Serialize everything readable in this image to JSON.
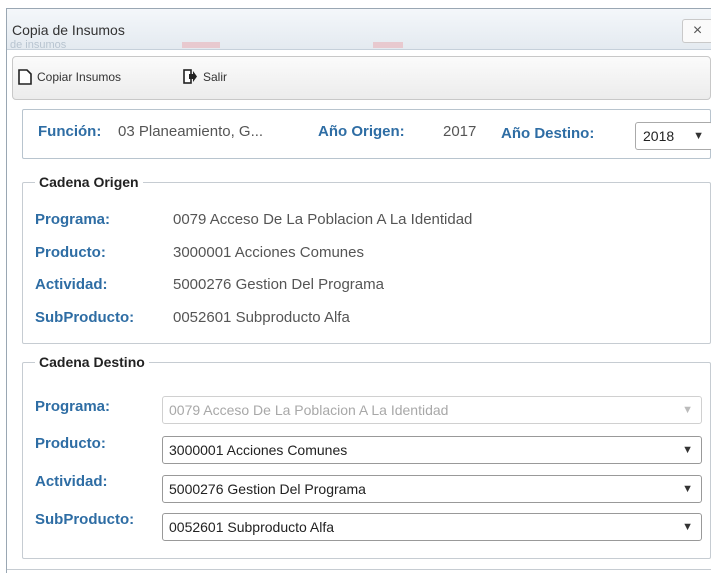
{
  "window": {
    "title": "Copia de Insumos",
    "close_symbol": "×",
    "background_ghost_text": "de insumos"
  },
  "toolbar": {
    "copy_label": "Copiar Insumos",
    "exit_label": "Salir"
  },
  "header": {
    "funcion_label": "Función:",
    "funcion_value": "03 Planeamiento, G...",
    "anio_origen_label": "Año Origen:",
    "anio_origen_value": "2017",
    "anio_destino_label": "Año Destino:",
    "anio_destino_value": "2018"
  },
  "origen": {
    "legend": "Cadena Origen",
    "rows": [
      {
        "label": "Programa:",
        "value": "0079 Acceso De La Poblacion A La Identidad"
      },
      {
        "label": "Producto:",
        "value": "3000001 Acciones Comunes"
      },
      {
        "label": "Actividad:",
        "value": "5000276 Gestion Del Programa"
      },
      {
        "label": "SubProducto:",
        "value": "0052601 Subproducto Alfa"
      }
    ]
  },
  "destino": {
    "legend": "Cadena Destino",
    "rows": [
      {
        "label": "Programa:",
        "value": "0079 Acceso De La Poblacion A La Identidad",
        "disabled": true
      },
      {
        "label": "Producto:",
        "value": "3000001 Acciones Comunes"
      },
      {
        "label": "Actividad:",
        "value": "5000276 Gestion Del Programa"
      },
      {
        "label": "SubProducto:",
        "value": "0052601 Subproducto Alfa"
      }
    ]
  },
  "colors": {
    "label_blue": "#2e6da4",
    "value_gray": "#555555",
    "ghost_red": "#d9a0a8"
  },
  "icons": {
    "copy": "document-icon",
    "exit": "exit-icon",
    "dropdown": "caret-down-icon"
  }
}
